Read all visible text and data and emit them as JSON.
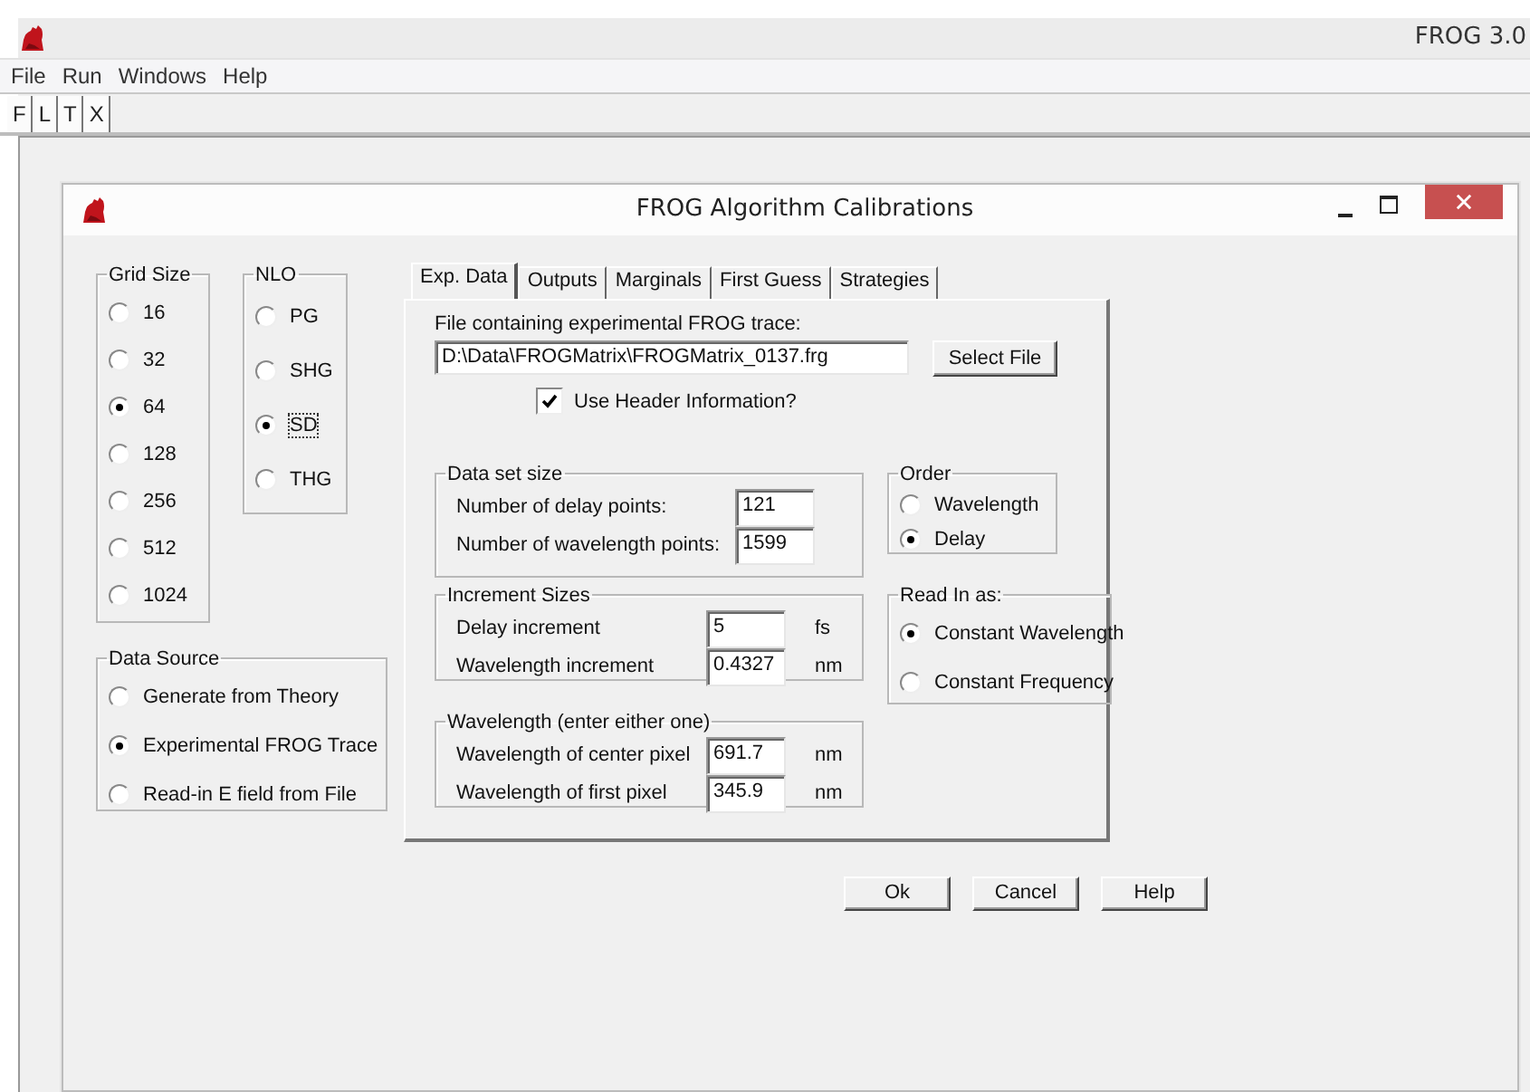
{
  "app": {
    "title": "FROG 3.0"
  },
  "menu": [
    "File",
    "Run",
    "Windows",
    "Help"
  ],
  "toolbar": [
    "F",
    "L",
    "T",
    "X"
  ],
  "dialog": {
    "title": "FROG Algorithm Calibrations",
    "grid_size": {
      "label": "Grid Size",
      "options": [
        {
          "label": "16",
          "selected": false
        },
        {
          "label": "32",
          "selected": false
        },
        {
          "label": "64",
          "selected": true
        },
        {
          "label": "128",
          "selected": false
        },
        {
          "label": "256",
          "selected": false
        },
        {
          "label": "512",
          "selected": false
        },
        {
          "label": "1024",
          "selected": false
        }
      ]
    },
    "nlo": {
      "label": "NLO",
      "options": [
        {
          "label": "PG",
          "selected": false,
          "focused": false
        },
        {
          "label": "SHG",
          "selected": false,
          "focused": false
        },
        {
          "label": "SD",
          "selected": true,
          "focused": true
        },
        {
          "label": "THG",
          "selected": false,
          "focused": false
        }
      ]
    },
    "data_source": {
      "label": "Data Source",
      "options": [
        {
          "label": "Generate from Theory",
          "selected": false
        },
        {
          "label": "Experimental FROG Trace",
          "selected": true
        },
        {
          "label": "Read-in E field from File",
          "selected": false
        }
      ]
    },
    "tabs": [
      {
        "label": "Exp. Data",
        "selected": true
      },
      {
        "label": "Outputs",
        "selected": false
      },
      {
        "label": "Marginals",
        "selected": false
      },
      {
        "label": "First Guess",
        "selected": false
      },
      {
        "label": "Strategies",
        "selected": false
      }
    ],
    "exp_data": {
      "file_label": "File containing experimental FROG trace:",
      "file_path": "D:\\Data\\FROGMatrix\\FROGMatrix_0137.frg",
      "select_button": "Select File",
      "use_header": {
        "label": "Use Header Information?",
        "checked": true
      },
      "data_set_size": {
        "label": "Data set size",
        "fields": [
          {
            "label": "Number of delay points:",
            "value": "121"
          },
          {
            "label": "Number of wavelength points:",
            "value": "1599"
          }
        ]
      },
      "order": {
        "label": "Order",
        "options": [
          {
            "label": "Wavelength",
            "selected": false
          },
          {
            "label": "Delay",
            "selected": true
          }
        ]
      },
      "increment_sizes": {
        "label": "Increment Sizes",
        "fields": [
          {
            "label": "Delay increment",
            "value": "5",
            "unit": "fs"
          },
          {
            "label": "Wavelength increment",
            "value": "0.4327",
            "unit": "nm"
          }
        ]
      },
      "read_in_as": {
        "label": "Read In as:",
        "options": [
          {
            "label": "Constant Wavelength",
            "selected": true
          },
          {
            "label": "Constant Frequency",
            "selected": false
          }
        ]
      },
      "wavelength": {
        "label": "Wavelength (enter either one)",
        "fields": [
          {
            "label": "Wavelength of center pixel",
            "value": "691.7",
            "unit": "nm"
          },
          {
            "label": "Wavelength of first pixel",
            "value": "345.9",
            "unit": "nm"
          }
        ]
      }
    },
    "buttons": [
      "Ok",
      "Cancel",
      "Help"
    ]
  }
}
